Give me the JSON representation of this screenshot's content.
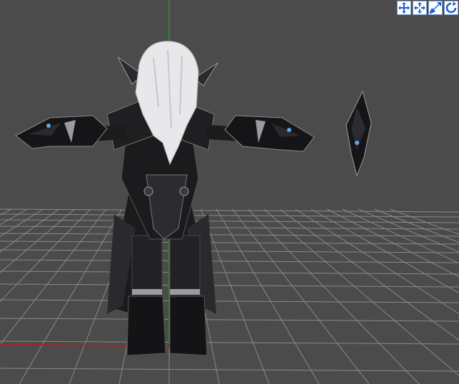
{
  "viewport": {
    "background": "#4b4b4b",
    "grid_color": "#8a8a8a",
    "axis_x_color": "#b02020",
    "axis_y_color": "#20a020",
    "axis_z_color": "#2030c0"
  },
  "toolbar": {
    "accent": "#1a5fcf",
    "buttons": [
      {
        "icon": "move-xy-icon"
      },
      {
        "icon": "move-xz-icon"
      },
      {
        "icon": "scale-icon"
      },
      {
        "icon": "rotate-icon"
      }
    ]
  },
  "model": {
    "armor_color": "#1b1b1d",
    "trim_color": "#9a9aa0",
    "hair_color": "#e8e8ea",
    "gem_color": "#5aa8e8"
  }
}
